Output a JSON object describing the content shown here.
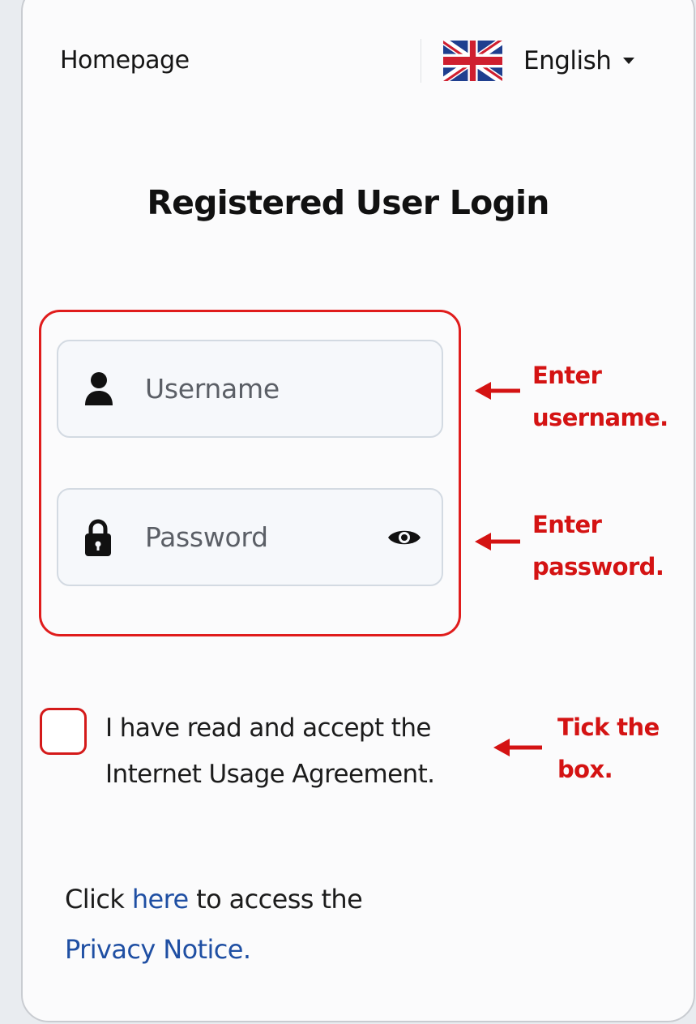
{
  "header": {
    "homepage_label": "Homepage",
    "language": {
      "flag_icon": "uk-flag-icon",
      "label": "English",
      "dropdown_icon": "caret-down-icon"
    }
  },
  "login": {
    "title": "Registered User Login",
    "username": {
      "icon": "user-icon",
      "placeholder": "Username"
    },
    "password": {
      "icon": "lock-icon",
      "placeholder": "Password",
      "toggle_icon": "eye-icon"
    }
  },
  "agreement": {
    "checked": false,
    "line1": "I have read and accept the",
    "line2": "Internet Usage Agreement."
  },
  "privacy": {
    "prefix": "Click",
    "link_text": "here",
    "middle": "to access the",
    "notice_text": "Privacy Notice."
  },
  "annotations": {
    "username": {
      "line1": "Enter",
      "line2": "username."
    },
    "password": {
      "line1": "Enter",
      "line2": "password."
    },
    "checkbox": {
      "line1": "Tick the",
      "line2": "box."
    }
  },
  "colors": {
    "annotation_red": "#d41313",
    "link_blue": "#1f4fa3"
  }
}
